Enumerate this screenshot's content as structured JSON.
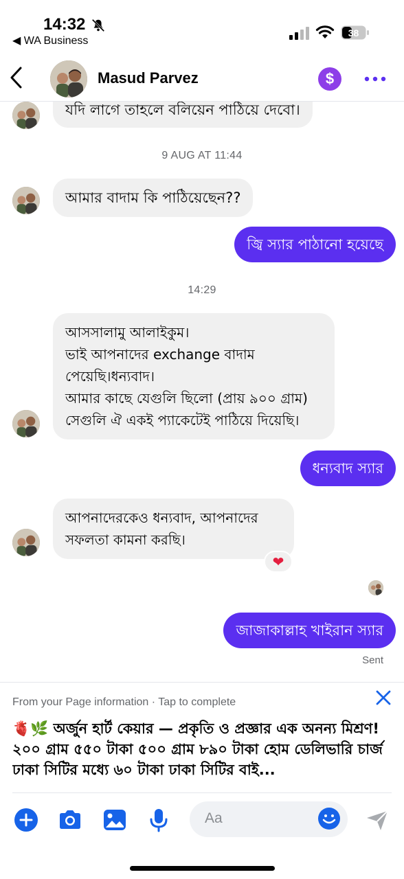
{
  "status_bar": {
    "time": "14:32",
    "back_app": "◀ WA Business",
    "battery": "38"
  },
  "header": {
    "contact_name": "Masud Parvez",
    "payment_icon": "$",
    "icons": {
      "back": "chevron-left-icon",
      "more": "more-dots-icon",
      "payment": "dollar-icon"
    }
  },
  "messages": [
    {
      "direction": "in",
      "text": "যদি লাগে তাহলে বলিয়েন পাঠিয়ে দেবো।"
    },
    {
      "timestamp": "9 AUG AT 11:44"
    },
    {
      "direction": "in",
      "text": "আমার বাদাম কি পাঠিয়েছেন??"
    },
    {
      "direction": "out",
      "text": "জ্বি স্যার পাঠানো হয়েছে"
    },
    {
      "timestamp": "14:29"
    },
    {
      "direction": "in",
      "lines": [
        "আসসালামু আলাইকুম।",
        "ভাই আপনাদের exchange  বাদাম",
        "পেয়েছি।ধন্যবাদ।",
        "আমার কাছে যেগুলি ছিলো (প্রায় ৯০০ গ্রাম)",
        "সেগুলি ঐ একই প্যাকেটেই পাঠিয়ে দিয়েছি।"
      ]
    },
    {
      "direction": "out",
      "text": "ধন্যবাদ স্যার"
    },
    {
      "direction": "in",
      "lines": [
        "আপনাদেরকেও ধন্যবাদ, আপনাদের",
        "সফলতা কামনা করছি।"
      ],
      "reaction": "❤"
    },
    {
      "direction": "out",
      "text": "জাজাকাল্লাহ খাইরান স্যার",
      "status": "Sent"
    }
  ],
  "info_banner": {
    "label": "From your Page information · Tap to complete",
    "text": "🫀🌿 অর্জুন হার্ট কেয়ার — প্রকৃতি ও প্রজ্ঞার এক অনন্য মিশ্রণ! ২০০ গ্রাম ৫৫০ টাকা ৫০০ গ্রাম ৮৯০ টাকা হোম ডেলিভারি চার্জ ঢাকা সিটির মধ্যে ৬০ টাকা ঢাকা সিটির বাই..."
  },
  "composer": {
    "placeholder": "Aa",
    "icons": [
      "plus-icon",
      "camera-icon",
      "gallery-icon",
      "microphone-icon",
      "emoji-icon",
      "send-icon"
    ]
  },
  "colors": {
    "accent": "#5b2ff0",
    "icon_blue": "#1763e8",
    "incoming_bubble": "#f0f0f0",
    "payment_purple": "#8d3ee8"
  }
}
